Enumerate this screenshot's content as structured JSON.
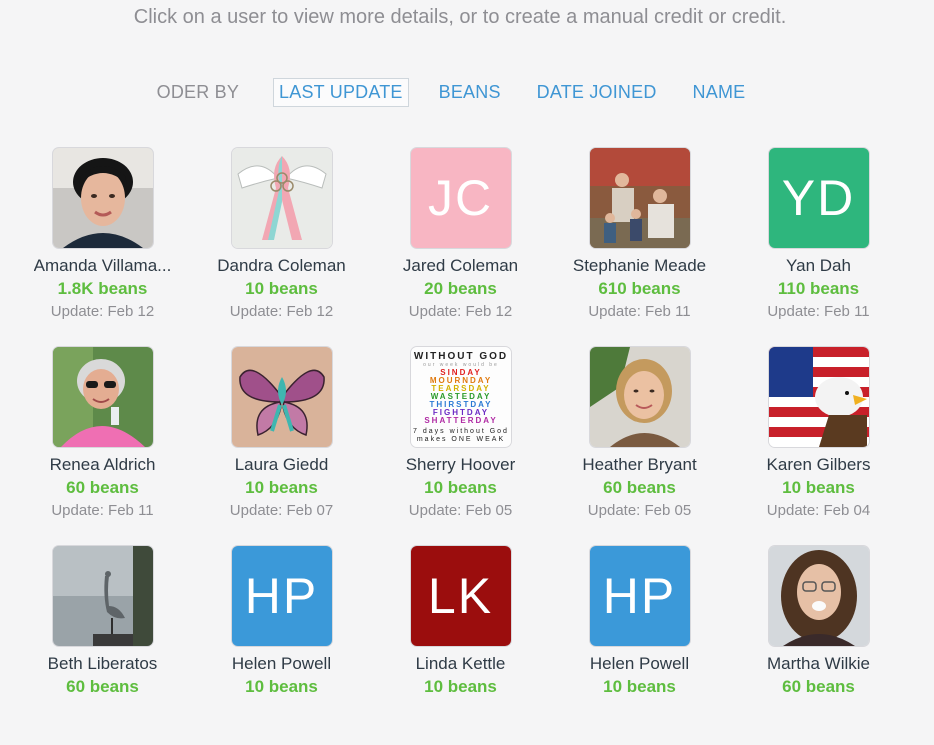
{
  "intro": "Click on a user to view more details, or to create a manual credit or credit.",
  "order": {
    "label": "ODER BY",
    "options": [
      "LAST UPDATE",
      "BEANS",
      "DATE JOINED",
      "NAME"
    ],
    "active": "LAST UPDATE"
  },
  "users": [
    {
      "name": "Amanda Villama...",
      "beans": "1.8K beans",
      "update": "Update: Feb 12",
      "avatar": "photo",
      "avatar_desc": "woman-portrait"
    },
    {
      "name": "Dandra Coleman",
      "beans": "10 beans",
      "update": "Update: Feb 12",
      "avatar": "photo",
      "avatar_desc": "ribbon-wings"
    },
    {
      "name": "Jared Coleman",
      "beans": "20 beans",
      "update": "Update: Feb 12",
      "avatar": "initials",
      "initials": "JC",
      "color": "#f8b6c3"
    },
    {
      "name": "Stephanie Meade",
      "beans": "610 beans",
      "update": "Update: Feb 11",
      "avatar": "photo",
      "avatar_desc": "family-outdoor"
    },
    {
      "name": "Yan Dah",
      "beans": "110 beans",
      "update": "Update: Feb 11",
      "avatar": "initials",
      "initials": "YD",
      "color": "#2eb67d"
    },
    {
      "name": "Renea Aldrich",
      "beans": "60 beans",
      "update": "Update: Feb 11",
      "avatar": "photo",
      "avatar_desc": "woman-sunglasses"
    },
    {
      "name": "Laura Giedd",
      "beans": "10 beans",
      "update": "Update: Feb 07",
      "avatar": "photo",
      "avatar_desc": "butterfly-tattoo"
    },
    {
      "name": "Sherry Hoover",
      "beans": "10 beans",
      "update": "Update: Feb 05",
      "avatar": "photo",
      "avatar_desc": "without-god-text"
    },
    {
      "name": "Heather Bryant",
      "beans": "60 beans",
      "update": "Update: Feb 05",
      "avatar": "photo",
      "avatar_desc": "woman-smiling"
    },
    {
      "name": "Karen Gilbers",
      "beans": "10 beans",
      "update": "Update: Feb 04",
      "avatar": "photo",
      "avatar_desc": "eagle-flag"
    },
    {
      "name": "Beth Liberatos",
      "beans": "60 beans",
      "update": "",
      "avatar": "photo",
      "avatar_desc": "heron-sky"
    },
    {
      "name": "Helen Powell",
      "beans": "10 beans",
      "update": "",
      "avatar": "initials",
      "initials": "HP",
      "color": "#3b99d9"
    },
    {
      "name": "Linda Kettle",
      "beans": "10 beans",
      "update": "",
      "avatar": "initials",
      "initials": "LK",
      "color": "#9b0d0d"
    },
    {
      "name": "Helen Powell",
      "beans": "10 beans",
      "update": "",
      "avatar": "initials",
      "initials": "HP",
      "color": "#3b99d9"
    },
    {
      "name": "Martha Wilkie",
      "beans": "60 beans",
      "update": "",
      "avatar": "photo",
      "avatar_desc": "woman-glasses"
    }
  ],
  "photo_text": {
    "title": "WITHOUT GOD",
    "sub": "our week would be",
    "lines": [
      "SINDAY",
      "MOURNDAY",
      "TEARSDAY",
      "WASTEDAY",
      "THIRSTDAY",
      "FIGHTDAY",
      "SHATTERDAY"
    ],
    "foot1": "7 days without God",
    "foot2": "makes ONE WEAK"
  }
}
